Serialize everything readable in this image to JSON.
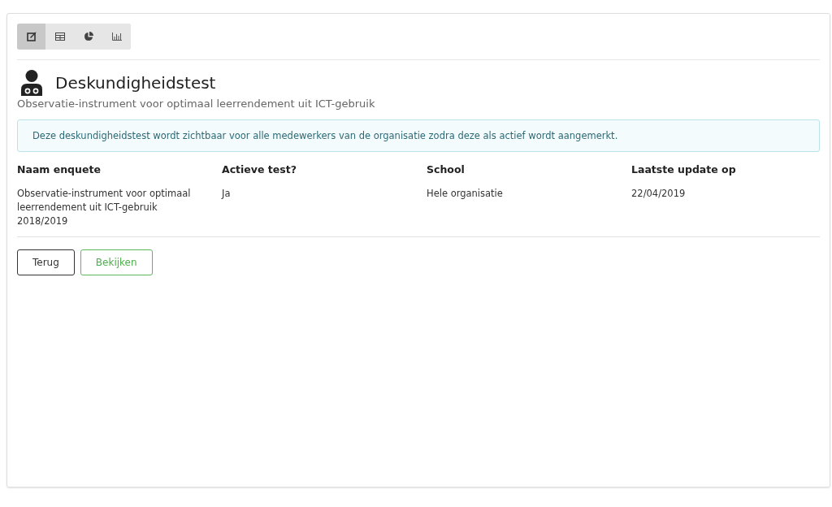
{
  "toolbar": [
    {
      "kind": "edit",
      "selected": true
    },
    {
      "kind": "table",
      "selected": false
    },
    {
      "kind": "pie",
      "selected": false
    },
    {
      "kind": "bars",
      "selected": false
    }
  ],
  "title": "Deskundigheidstest",
  "subtitle": "Observatie-instrument voor optimaal leerrendement uit ICT-gebruik",
  "alert": "Deze deskundigheidstest wordt zichtbaar voor alle medewerkers van de organisatie zodra deze als actief wordt aangemerkt.",
  "table": {
    "columns": [
      "Naam enquete",
      "Actieve test?",
      "School",
      "Laatste update op"
    ],
    "rows": [
      [
        "Observatie-instrument voor optimaal leerrendement uit ICT-gebruik 2018/2019",
        "Ja",
        "Hele organisatie",
        "22/04/2019"
      ]
    ]
  },
  "buttons": [
    {
      "label": "Terug",
      "kind": "default"
    },
    {
      "label": "Bekijken",
      "kind": "success"
    }
  ]
}
